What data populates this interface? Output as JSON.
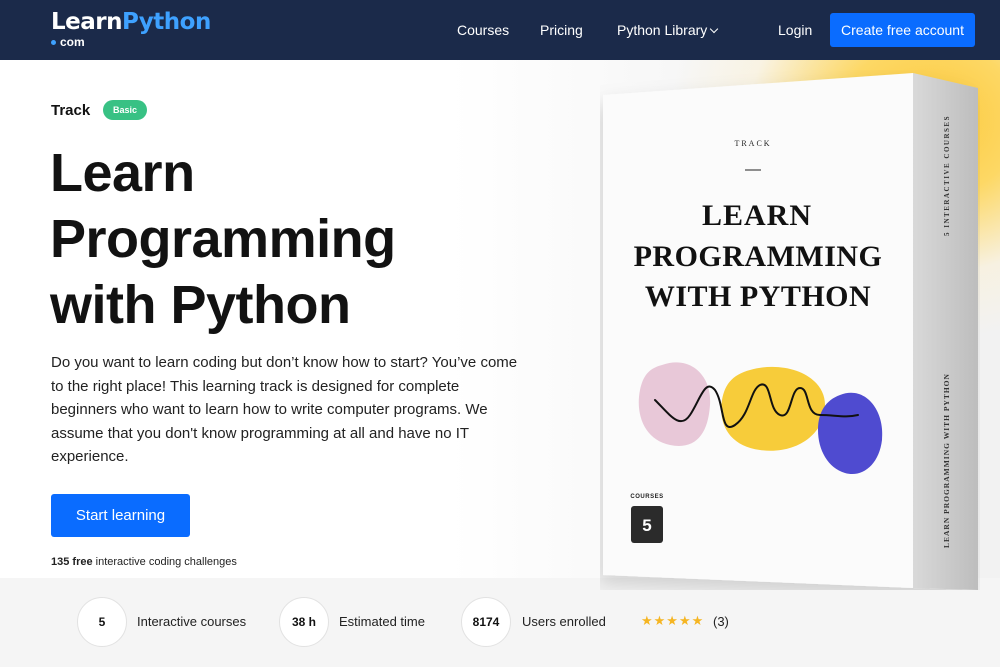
{
  "nav": {
    "logo_word1": "Learn",
    "logo_word2": "Python",
    "logo_sub": "com",
    "links": [
      "Courses",
      "Pricing",
      "Python Library"
    ],
    "login": "Login",
    "cta": "Create free account"
  },
  "hero": {
    "track_label": "Track",
    "badge": "Basic",
    "title_line1": "Learn",
    "title_line2": "Programming",
    "title_line3": "with Python",
    "description": "Do you want to learn coding but don’t know how to start? You’ve come to the right place! This learning track is designed for complete beginners who want to learn how to write computer programs. We assume that you don't know programming at all and have no IT experience.",
    "start_button": "Start learning",
    "challenges_count": "135 free",
    "challenges_text": " interactive coding challenges"
  },
  "stats": [
    {
      "value": "5",
      "label": "Interactive courses"
    },
    {
      "value": "38 h",
      "label": "Estimated time"
    },
    {
      "value": "8174",
      "label": "Users enrolled"
    }
  ],
  "rating": {
    "stars": "★★★★★",
    "count": "(3)"
  },
  "box": {
    "track": "TRACK",
    "title_line1": "LEARN",
    "title_line2": "PROGRAMMING",
    "title_line3": "WITH PYTHON",
    "courses_label": "COURSES",
    "courses_count": "5",
    "side_top": "5 INTERACTIVE COURSES",
    "side_bottom": "LEARN PROGRAMMING WITH PYTHON"
  },
  "colors": {
    "nav_bg": "#1b2a4a",
    "accent": "#0a6cff",
    "logo_blue": "#3ea1ff",
    "badge": "#38c184",
    "blob_pink": "#e8c8d8",
    "blob_yellow": "#f7cc3a",
    "blob_blue": "#4f4bd0"
  }
}
